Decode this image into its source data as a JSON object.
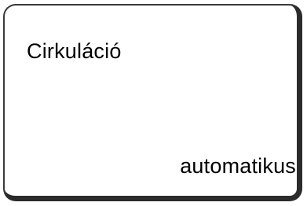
{
  "display": {
    "title": "Cirkuláció",
    "value": "automatikus"
  }
}
